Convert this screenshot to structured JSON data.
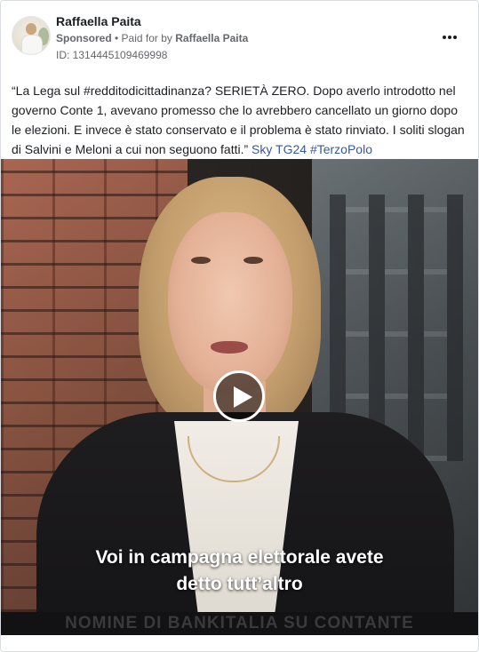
{
  "post": {
    "page_name": "Raffaella Paita",
    "sponsored_label": "Sponsored",
    "separator": " • ",
    "paid_for_prefix": "Paid for by ",
    "paid_for_name": "Raffaella Paita",
    "ad_id": "ID: 1314445109469998",
    "more_icon": "more-horizontal-icon",
    "caption_text": "“La Lega sul #redditodicittadinanza? SERIETÀ ZERO. Dopo averlo introdotto nel governo Conte 1, avevano promesso che lo avrebbero cancellato un giorno dopo le elezioni. E invece è stato conservato e il problema è stato rinviato. I soliti slogan di Salvini e Meloni a cui non seguono fatti.” ",
    "caption_link_1": "Sky TG24",
    "caption_link_2": "#TerzoPolo"
  },
  "video": {
    "subtitle_line_1": "Voi in campagna elettorale avete",
    "subtitle_line_2": "detto tutt’altro",
    "ticker_text": "NOMINE DI BANKITALIA SU CONTANTE",
    "play_icon": "play-icon"
  },
  "colors": {
    "link": "#385898",
    "secondary_text": "#65676b",
    "border": "#dadde1"
  }
}
